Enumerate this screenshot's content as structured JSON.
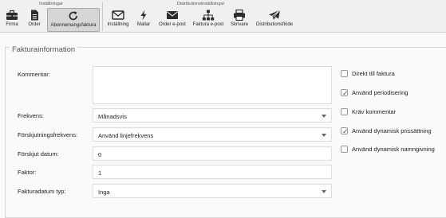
{
  "ribbon": {
    "groups": {
      "installningar": "Inställningar",
      "distribution": "Distributionsinställningar"
    },
    "buttons": {
      "firma": "Firma",
      "order": "Order",
      "abonnemang": "Abonnemangsfaktura",
      "installning": "Inställning",
      "mallar": "Mallar",
      "order_epost": "Order e-post",
      "faktura_epost": "Faktura e-post",
      "skrivare": "Skrivare",
      "distributionsflode": "Distributionsflöde"
    },
    "icons": {
      "firma": "briefcase-icon",
      "order": "document-icon",
      "abonnemang": "refresh-icon",
      "installning": "envelope-icon",
      "mallar": "lightning-icon",
      "order_epost": "envelope-icon",
      "faktura_epost": "sitemap-icon",
      "skrivare": "printer-icon",
      "distributionsflode": "paper-plane-icon"
    },
    "active_tab": "Abonnemangsfaktura"
  },
  "section": {
    "title": "Fakturainformation"
  },
  "form": {
    "kommentar": {
      "label": "Kommentar:",
      "value": ""
    },
    "frekvens": {
      "label": "Frekvens:",
      "value": "Månadsvis"
    },
    "forskjutningsfrekvens": {
      "label": "Förskjutningsfrekvens:",
      "value": "Använd linjefrekvens"
    },
    "forskjut_datum": {
      "label": "Förskjut datum:",
      "value": "0"
    },
    "faktor": {
      "label": "Faktor:",
      "value": "1"
    },
    "fakturadatum_typ": {
      "label": "Fakturadatum typ:",
      "value": "Inga"
    }
  },
  "checkboxes": {
    "direkt": {
      "label": "Direkt till faktura",
      "checked": false
    },
    "periodisering": {
      "label": "Använd periodisering",
      "checked": true
    },
    "krav": {
      "label": "Kräv kommentar",
      "checked": false
    },
    "prissattning": {
      "label": "Använd dynamisk prissättning",
      "checked": true
    },
    "namngivning": {
      "label": "Använd dynamisk namngivning",
      "checked": false
    }
  },
  "colors": {
    "ribbon_bg": "#f0f0f0",
    "active_tab_bg": "#d6d6d6",
    "page_bg": "#fafafa"
  }
}
